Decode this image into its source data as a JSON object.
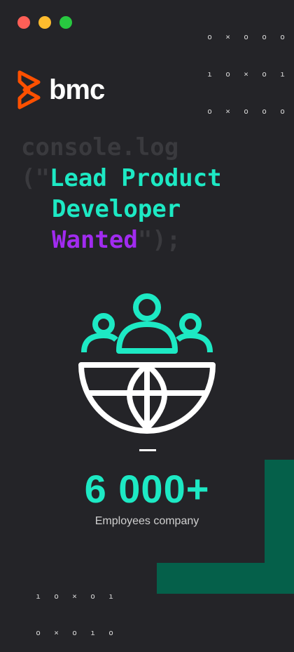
{
  "window": {
    "controls": [
      {
        "name": "close",
        "color": "#ff5f57"
      },
      {
        "name": "minimize",
        "color": "#febc2e"
      },
      {
        "name": "maximize",
        "color": "#28c840"
      }
    ]
  },
  "top_pattern": [
    [
      "o",
      "×",
      "o",
      "o",
      "o"
    ],
    [
      "ı",
      "o",
      "×",
      "o",
      "ı"
    ],
    [
      "o",
      "×",
      "o",
      "o",
      "o"
    ]
  ],
  "bottom_pattern": [
    [
      "ı",
      "o",
      "×",
      "o",
      "ı"
    ],
    [
      "o",
      "×",
      "o",
      "ı",
      "o"
    ]
  ],
  "brand": {
    "name": "bmc",
    "color": "#fe5000"
  },
  "code": {
    "prefix": "console.log",
    "open": "(\"",
    "line1": "Lead Product",
    "line2": "Developer",
    "line3": "Wanted",
    "close": "\");"
  },
  "stat": {
    "value": "6 000+",
    "label": "Employees company"
  },
  "colors": {
    "accent": "#1de9c4",
    "highlight": "#a12bf0",
    "background": "#242428",
    "deco": "#05604a"
  }
}
